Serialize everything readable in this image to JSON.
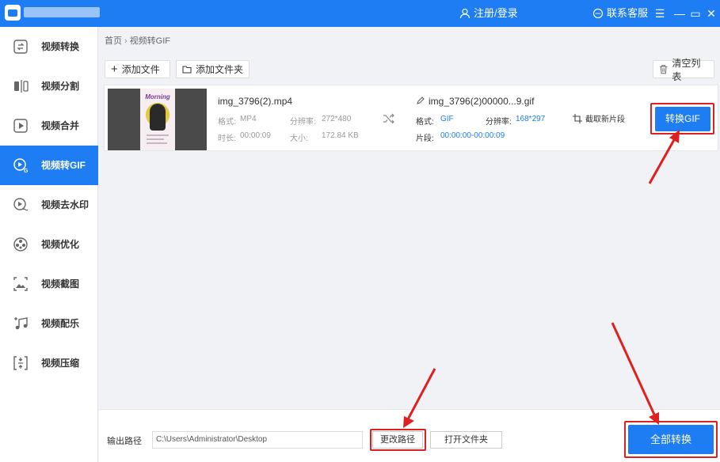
{
  "titlebar": {
    "login_label": "注册/登录",
    "service_label": "联系客服",
    "menu_glyph": "☰",
    "minimize_glyph": "—",
    "maximize_glyph": "▭",
    "close_glyph": "✕"
  },
  "sidebar": {
    "items": [
      {
        "label": "视频转换",
        "icon": "convert-icon"
      },
      {
        "label": "视频分割",
        "icon": "split-icon"
      },
      {
        "label": "视频合并",
        "icon": "merge-icon"
      },
      {
        "label": "视频转GIF",
        "icon": "gif-icon",
        "active": true
      },
      {
        "label": "视频去水印",
        "icon": "watermark-icon"
      },
      {
        "label": "视频优化",
        "icon": "optimize-icon"
      },
      {
        "label": "视频截图",
        "icon": "screenshot-icon"
      },
      {
        "label": "视频配乐",
        "icon": "music-icon"
      },
      {
        "label": "视频压缩",
        "icon": "compress-icon"
      }
    ]
  },
  "breadcrumb": {
    "home": "首页",
    "current": "视频转GIF"
  },
  "toolbar": {
    "add_file": "添加文件",
    "add_folder": "添加文件夹",
    "clear_list": "清空列表"
  },
  "file": {
    "name": "img_3796(2).mp4",
    "format_key": "格式:",
    "format_value": "MP4",
    "resolution_key": "分辨率:",
    "resolution_value": "272*480",
    "duration_key": "时长:",
    "duration_value": "00:00:09",
    "size_key": "大小:",
    "size_value": "172.84 KB",
    "thumb_title": "Morning"
  },
  "output": {
    "name": "img_3796(2)00000...9.gif",
    "format_key": "格式:",
    "format_value": "GIF",
    "resolution_key": "分辨率:",
    "resolution_value": "168*297",
    "segment_key": "片段:",
    "segment_value": "00:00:00-00:00:09",
    "crop_label": "截取新片段",
    "convert_label": "转换GIF"
  },
  "bottom": {
    "path_label": "输出路径",
    "path_value": "C:\\Users\\Administrator\\Desktop",
    "change_path": "更改路径",
    "open_folder": "打开文件夹",
    "convert_all": "全部转换"
  },
  "colors": {
    "accent": "#1e7df2",
    "highlight": "#e02020"
  }
}
